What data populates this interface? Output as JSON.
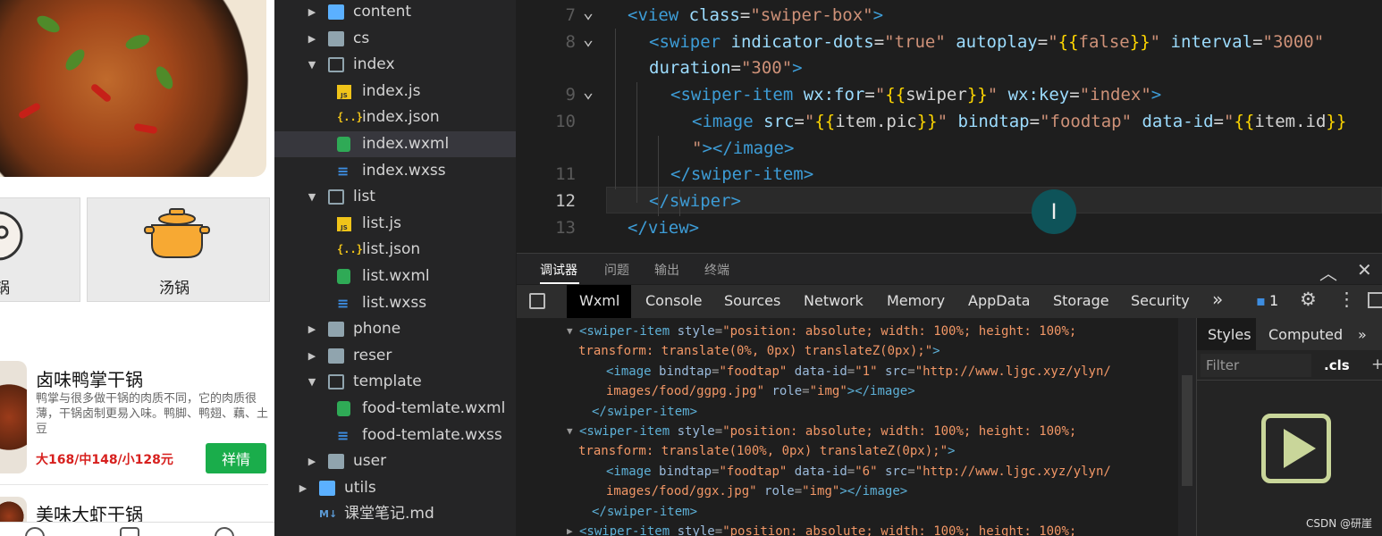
{
  "phone": {
    "categories": [
      {
        "label": "锅"
      },
      {
        "label": "汤锅"
      }
    ],
    "products": [
      {
        "title": "卤味鸭掌干锅",
        "description": "鸭掌与很多做干锅的肉质不同，它的肉质很薄，干锅卤制更易入味。鸭脚、鸭翅、藕、土豆",
        "price": "大168/中148/小128元",
        "button": "祥情"
      },
      {
        "title": "美味大虾干锅"
      }
    ]
  },
  "filetree": {
    "items": [
      {
        "label": "content",
        "type": "folder-special",
        "level": 0,
        "expanded": false
      },
      {
        "label": "cs",
        "type": "folder",
        "level": 0,
        "expanded": false
      },
      {
        "label": "index",
        "type": "folder",
        "level": 0,
        "expanded": true
      },
      {
        "label": "index.js",
        "type": "js",
        "level": 1
      },
      {
        "label": "index.json",
        "type": "json",
        "level": 1
      },
      {
        "label": "index.wxml",
        "type": "wxml",
        "level": 1,
        "selected": true
      },
      {
        "label": "index.wxss",
        "type": "wxss",
        "level": 1
      },
      {
        "label": "list",
        "type": "folder",
        "level": 0,
        "expanded": true
      },
      {
        "label": "list.js",
        "type": "js",
        "level": 1
      },
      {
        "label": "list.json",
        "type": "json",
        "level": 1
      },
      {
        "label": "list.wxml",
        "type": "wxml",
        "level": 1
      },
      {
        "label": "list.wxss",
        "type": "wxss",
        "level": 1
      },
      {
        "label": "phone",
        "type": "folder",
        "level": 0,
        "expanded": false
      },
      {
        "label": "reser",
        "type": "folder",
        "level": 0,
        "expanded": false
      },
      {
        "label": "template",
        "type": "folder",
        "level": 0,
        "expanded": true
      },
      {
        "label": "food-temlate.wxml",
        "type": "wxml",
        "level": 1
      },
      {
        "label": "food-temlate.wxss",
        "type": "wxss",
        "level": 1
      },
      {
        "label": "user",
        "type": "folder",
        "level": 0,
        "expanded": false
      },
      {
        "label": "utils",
        "type": "folder-special",
        "level": -1,
        "expanded": false
      },
      {
        "label": "课堂笔记.md",
        "type": "md",
        "level": -1
      }
    ]
  },
  "editor": {
    "current_line": "12",
    "lines": [
      {
        "num": "7",
        "fold": true,
        "indent": 1,
        "parts": [
          [
            "tag",
            "<view"
          ],
          [
            "pl",
            " "
          ],
          [
            "attr",
            "class"
          ],
          [
            "pl",
            "="
          ],
          [
            "val",
            "\"swiper-box\""
          ],
          [
            "tag",
            ">"
          ]
        ]
      },
      {
        "num": "8",
        "fold": true,
        "indent": 2,
        "parts": [
          [
            "tag",
            "<swiper"
          ],
          [
            "pl",
            " "
          ],
          [
            "attr",
            "indicator-dots"
          ],
          [
            "pl",
            "="
          ],
          [
            "val",
            "\"true\""
          ],
          [
            "pl",
            " "
          ],
          [
            "attr",
            "autoplay"
          ],
          [
            "pl",
            "="
          ],
          [
            "val",
            "\""
          ],
          [
            "br",
            "{{"
          ],
          [
            "val",
            "false"
          ],
          [
            "br",
            "}}"
          ],
          [
            "val",
            "\""
          ],
          [
            "pl",
            " "
          ],
          [
            "attr",
            "interval"
          ],
          [
            "pl",
            "="
          ],
          [
            "val",
            "\"3000\""
          ]
        ]
      },
      {
        "num": "",
        "fold": false,
        "indent": 2,
        "parts": [
          [
            "attr",
            "duration"
          ],
          [
            "pl",
            "="
          ],
          [
            "val",
            "\"300\""
          ],
          [
            "tag",
            ">"
          ]
        ]
      },
      {
        "num": "9",
        "fold": true,
        "indent": 3,
        "parts": [
          [
            "tag",
            "<swiper-item"
          ],
          [
            "pl",
            " "
          ],
          [
            "attr",
            "wx:for"
          ],
          [
            "pl",
            "="
          ],
          [
            "val",
            "\""
          ],
          [
            "br",
            "{{"
          ],
          [
            "pl",
            "swiper"
          ],
          [
            "br",
            "}}"
          ],
          [
            "val",
            "\""
          ],
          [
            "pl",
            " "
          ],
          [
            "attr",
            "wx:key"
          ],
          [
            "pl",
            "="
          ],
          [
            "val",
            "\"index\""
          ],
          [
            "tag",
            ">"
          ]
        ]
      },
      {
        "num": "10",
        "fold": false,
        "indent": 4,
        "parts": [
          [
            "tag",
            "<image"
          ],
          [
            "pl",
            " "
          ],
          [
            "attr",
            "src"
          ],
          [
            "pl",
            "="
          ],
          [
            "val",
            "\""
          ],
          [
            "br",
            "{{"
          ],
          [
            "pl",
            "item.pic"
          ],
          [
            "br",
            "}}"
          ],
          [
            "val",
            "\""
          ],
          [
            "pl",
            " "
          ],
          [
            "attr",
            "bindtap"
          ],
          [
            "pl",
            "="
          ],
          [
            "val",
            "\"foodtap\""
          ],
          [
            "pl",
            " "
          ],
          [
            "attr",
            "data-id"
          ],
          [
            "pl",
            "="
          ],
          [
            "val",
            "\""
          ],
          [
            "br",
            "{{"
          ],
          [
            "pl",
            "item.id"
          ],
          [
            "br",
            "}}"
          ]
        ]
      },
      {
        "num": "",
        "fold": false,
        "indent": 4,
        "parts": [
          [
            "val",
            "\""
          ],
          [
            "tag",
            "></image>"
          ]
        ]
      },
      {
        "num": "11",
        "fold": false,
        "indent": 3,
        "parts": [
          [
            "tag",
            "</swiper-item>"
          ]
        ]
      },
      {
        "num": "12",
        "fold": false,
        "indent": 2,
        "parts": [
          [
            "tag",
            "</swiper>"
          ]
        ]
      },
      {
        "num": "13",
        "fold": false,
        "indent": 1,
        "parts": [
          [
            "tag",
            "</view>"
          ]
        ]
      }
    ]
  },
  "devtools": {
    "top_tabs": [
      "调试器",
      "问题",
      "输出",
      "终端"
    ],
    "panel_tabs": [
      "Wxml",
      "Console",
      "Sources",
      "Network",
      "Memory",
      "AppData",
      "Storage",
      "Security"
    ],
    "issue_count": "1",
    "dom_lines": [
      {
        "indent": 0,
        "tri": "▼",
        "parts": [
          [
            "tag",
            "<swiper-item"
          ],
          [
            "pl",
            " "
          ],
          [
            "attr",
            "style"
          ],
          [
            "pl",
            "="
          ],
          [
            "val",
            "\"position: absolute; width: 100%; height: 100%;"
          ]
        ]
      },
      {
        "indent": -1,
        "tri": "",
        "parts": [
          [
            "val",
            "transform: translate(0%, 0px) translateZ(0px);\""
          ],
          [
            "tag",
            ">"
          ]
        ]
      },
      {
        "indent": 2,
        "tri": "",
        "parts": [
          [
            "tag",
            "<image"
          ],
          [
            "pl",
            " "
          ],
          [
            "attr",
            "bindtap"
          ],
          [
            "pl",
            "="
          ],
          [
            "val",
            "\"foodtap\""
          ],
          [
            "pl",
            " "
          ],
          [
            "attr",
            "data-id"
          ],
          [
            "pl",
            "="
          ],
          [
            "val",
            "\"1\""
          ],
          [
            "pl",
            " "
          ],
          [
            "attr",
            "src"
          ],
          [
            "pl",
            "="
          ],
          [
            "val",
            "\"http://www.ljgc.xyz/ylyn/"
          ]
        ]
      },
      {
        "indent": 2,
        "tri": "",
        "parts": [
          [
            "val",
            "images/food/ggpg.jpg\""
          ],
          [
            "pl",
            " "
          ],
          [
            "attr",
            "role"
          ],
          [
            "pl",
            "="
          ],
          [
            "val",
            "\"img\""
          ],
          [
            "tag",
            "></image>"
          ]
        ]
      },
      {
        "indent": 1,
        "tri": "",
        "parts": [
          [
            "tag",
            "</swiper-item>"
          ]
        ]
      },
      {
        "indent": 0,
        "tri": "▼",
        "parts": [
          [
            "tag",
            "<swiper-item"
          ],
          [
            "pl",
            " "
          ],
          [
            "attr",
            "style"
          ],
          [
            "pl",
            "="
          ],
          [
            "val",
            "\"position: absolute; width: 100%; height: 100%;"
          ]
        ]
      },
      {
        "indent": -1,
        "tri": "",
        "parts": [
          [
            "val",
            "transform: translate(100%, 0px) translateZ(0px);\""
          ],
          [
            "tag",
            ">"
          ]
        ]
      },
      {
        "indent": 2,
        "tri": "",
        "parts": [
          [
            "tag",
            "<image"
          ],
          [
            "pl",
            " "
          ],
          [
            "attr",
            "bindtap"
          ],
          [
            "pl",
            "="
          ],
          [
            "val",
            "\"foodtap\""
          ],
          [
            "pl",
            " "
          ],
          [
            "attr",
            "data-id"
          ],
          [
            "pl",
            "="
          ],
          [
            "val",
            "\"6\""
          ],
          [
            "pl",
            " "
          ],
          [
            "attr",
            "src"
          ],
          [
            "pl",
            "="
          ],
          [
            "val",
            "\"http://www.ljgc.xyz/ylyn/"
          ]
        ]
      },
      {
        "indent": 2,
        "tri": "",
        "parts": [
          [
            "val",
            "images/food/ggx.jpg\""
          ],
          [
            "pl",
            " "
          ],
          [
            "attr",
            "role"
          ],
          [
            "pl",
            "="
          ],
          [
            "val",
            "\"img\""
          ],
          [
            "tag",
            "></image>"
          ]
        ]
      },
      {
        "indent": 1,
        "tri": "",
        "parts": [
          [
            "tag",
            "</swiper-item>"
          ]
        ]
      },
      {
        "indent": 0,
        "tri": "▶",
        "parts": [
          [
            "tag",
            "<swiper-item"
          ],
          [
            "pl",
            " "
          ],
          [
            "attr",
            "style"
          ],
          [
            "pl",
            "="
          ],
          [
            "val",
            "\"position: absolute; width: 100%; height: 100%;"
          ]
        ]
      }
    ],
    "styles_tabs": [
      "Styles",
      "Computed"
    ],
    "filter_placeholder": "Filter",
    "cls_label": ".cls"
  },
  "watermark": "CSDN @研崖",
  "colors": {
    "accent_green": "#1aad4b",
    "price_red": "#d7201e",
    "tag_blue": "#3d9cd6",
    "string_orange": "#ce9178",
    "bracket_gold": "#ffd700"
  },
  "icons": [
    "face-icon",
    "pot-icon",
    "play-icon",
    "settings-icon",
    "kebab-icon",
    "inspect-icon",
    "close-icon",
    "collapse-icon"
  ]
}
